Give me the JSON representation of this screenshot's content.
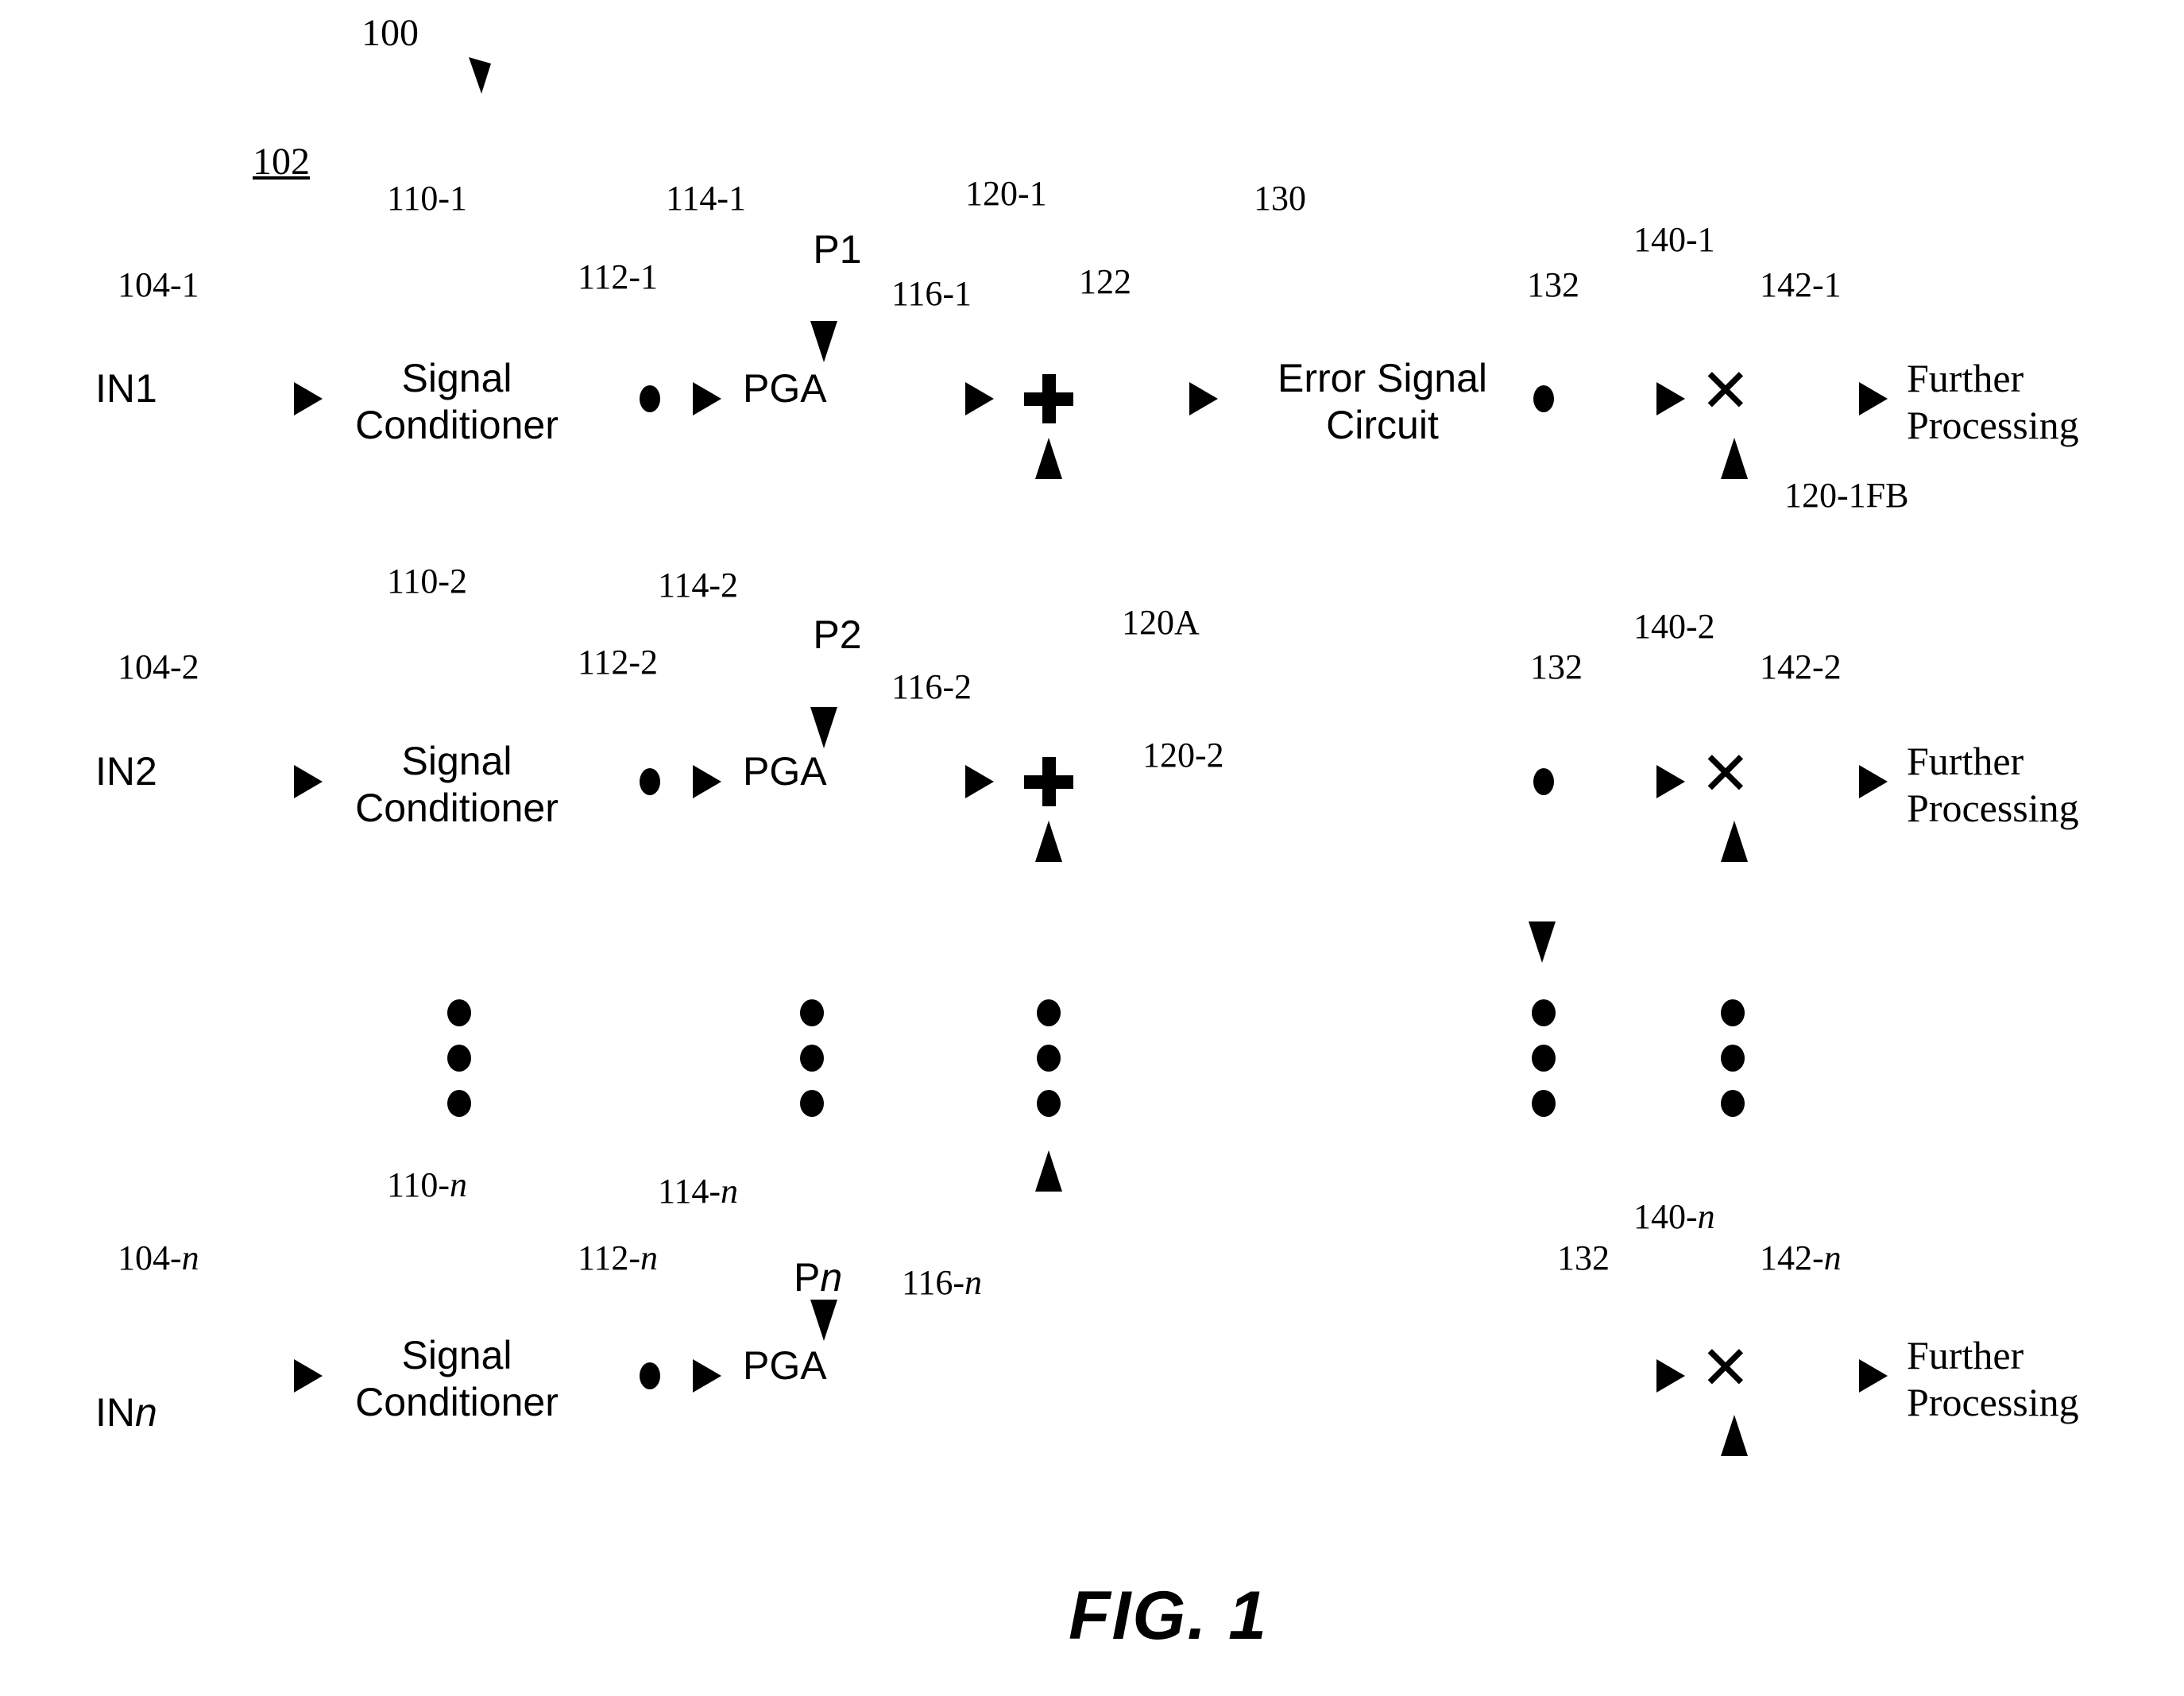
{
  "figure": {
    "label": "FIG. 1",
    "system_ref": "100",
    "subsystem_ref": "102"
  },
  "blocks": {
    "signal_conditioner": "Signal\nConditioner",
    "pga": "PGA",
    "error_signal_circuit": "Error Signal\nCircuit",
    "further_processing": "Further\nProcessing"
  },
  "channels": [
    {
      "index": "1",
      "input_label": "IN1",
      "input_ref": "104-1",
      "conditioner_ref": "110-1",
      "tap_ref": "112-1",
      "pga_ref": "114-1",
      "gain_control_label": "P1",
      "pga_out_ref": "116-1",
      "sum_ref": "120-1",
      "sum_out_ref": "122",
      "err_node_ref": "132",
      "mult_ref": "140-1",
      "mult_out_ref": "142-1",
      "feedback_ref": "120-1FB"
    },
    {
      "index": "2",
      "input_label": "IN2",
      "input_ref": "104-2",
      "conditioner_ref": "110-2",
      "tap_ref": "112-2",
      "pga_ref": "114-2",
      "gain_control_label": "P2",
      "pga_out_ref": "116-2",
      "sum_ref": "120-2",
      "sum_group_ref": "120A",
      "err_node_ref": "132",
      "mult_ref": "140-2",
      "mult_out_ref": "142-2"
    },
    {
      "index": "n",
      "input_label_prefix": "IN",
      "input_label_suffix": "n",
      "input_ref_prefix": "104-",
      "input_ref_suffix": "n",
      "conditioner_ref_prefix": "110-",
      "conditioner_ref_suffix": "n",
      "tap_ref_prefix": "112-",
      "tap_ref_suffix": "n",
      "pga_ref_prefix": "114-",
      "pga_ref_suffix": "n",
      "gain_control_prefix": "P",
      "gain_control_suffix": "n",
      "pga_out_ref_prefix": "116-",
      "pga_out_ref_suffix": "n",
      "err_node_ref": "132",
      "mult_ref_prefix": "140-",
      "mult_ref_suffix": "n",
      "mult_out_ref_prefix": "142-",
      "mult_out_ref_suffix": "n"
    }
  ],
  "shared_refs": {
    "error_circuit_ref": "130"
  },
  "colors": {
    "ink": "#000000",
    "paper": "#ffffff"
  }
}
